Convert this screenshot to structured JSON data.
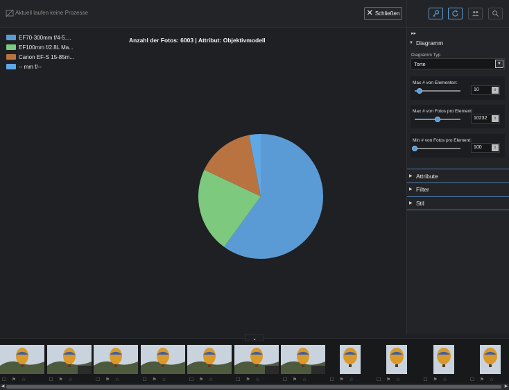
{
  "topbar": {
    "process_text": "Aktuell laufen keine Prozesse",
    "close_label": "Schließen"
  },
  "chart_data": {
    "type": "pie",
    "title": "Anzahl der Fotos: 6003 | Attribut: Objektivmodell",
    "categories": [
      "EF70-300mm f/4-5....",
      "EF100mm f/2.8L Ma...",
      "Canon EF-S 15-85m...",
      "-- mm f/--"
    ],
    "values": [
      60,
      22,
      15,
      3
    ],
    "colors": [
      "#5b9bd5",
      "#7dc97d",
      "#b87340",
      "#5fa8e6"
    ]
  },
  "panel": {
    "collapse_glyph": "▸▸",
    "diagram_section": "Diagramm",
    "diagram_type_label": "Diagramm Typ",
    "diagram_type_value": "Torte",
    "max_elements_label": "Max # von Elementen:",
    "max_elements_value": "10",
    "max_elements_level": 0.1,
    "max_photos_label": "Max # von Fotos pro Element:",
    "max_photos_value": "10232",
    "max_photos_level": 0.5,
    "min_photos_label": "Min # von Fotos pro Element:",
    "min_photos_value": "100",
    "min_photos_level": 0.0,
    "attribute_section": "Attribute",
    "filter_section": "Filter",
    "style_section": "Stil"
  },
  "toolbar_icons": [
    "key-icon",
    "refresh-icon",
    "people-icon",
    "zoom-icon"
  ],
  "filmstrip": {
    "thumb_count": 11
  }
}
